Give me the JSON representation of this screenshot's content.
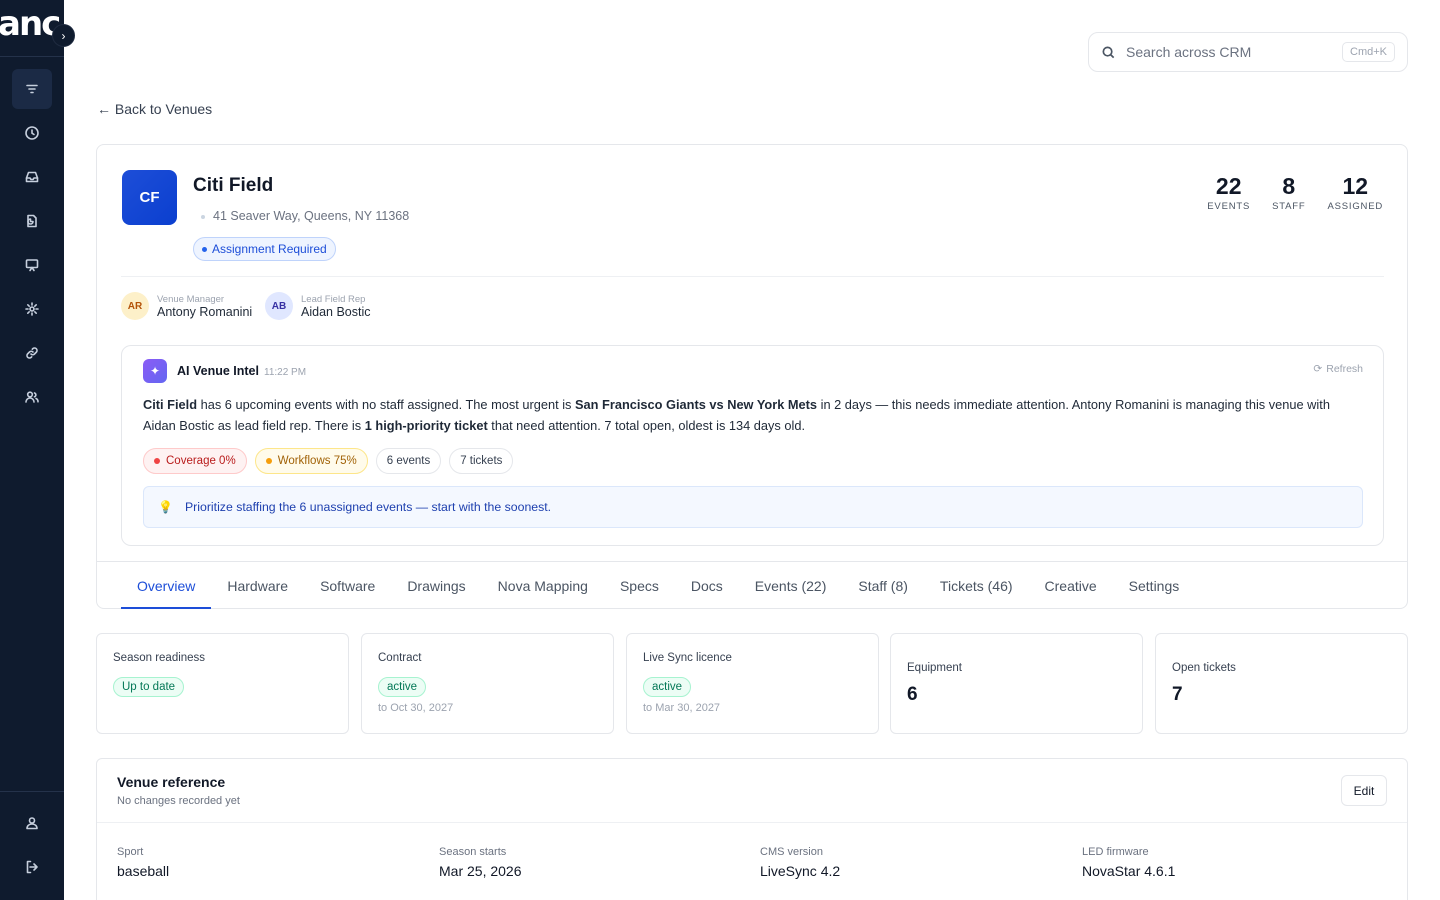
{
  "app": {
    "logo_text": "anc"
  },
  "search": {
    "placeholder": "Search across CRM",
    "shortcut": "Cmd+K"
  },
  "back_link": "← Back to Venues",
  "venue": {
    "initials": "CF",
    "name": "Citi Field",
    "address": "41 Seaver Way, Queens, NY 11368",
    "badge": "Assignment Required",
    "stats": [
      {
        "value": "22",
        "label": "EVENTS"
      },
      {
        "value": "8",
        "label": "STAFF"
      },
      {
        "value": "12",
        "label": "ASSIGNED"
      }
    ],
    "people": [
      {
        "initials": "AR",
        "role": "Venue Manager",
        "name": "Antony Romanini"
      },
      {
        "initials": "AB",
        "role": "Lead Field Rep",
        "name": "Aidan Bostic"
      }
    ]
  },
  "ai": {
    "title": "AI Venue Intel",
    "time": "11:22 PM",
    "refresh_label": "Refresh",
    "text": {
      "p1_bold": "Citi Field",
      "p1": " has 6 upcoming events with no staff assigned. The most urgent is ",
      "p2_bold": "San Francisco Giants vs New York Mets",
      "p2": " in 2 days — this needs immediate attention. Antony Romanini is managing this venue with Aidan Bostic as lead field rep. There is ",
      "p3_bold": "1 high-priority ticket",
      "p3": " that need attention. 7 total open, oldest is 134 days old."
    },
    "chips": [
      "Coverage 0%",
      "Workflows 75%",
      "6 events",
      "7 tickets"
    ],
    "tip": "Prioritize staffing the 6 unassigned events — start with the soonest.",
    "colors": {
      "coverage": "#ef4444",
      "workflows": "#f59e0b"
    }
  },
  "tabs": [
    "Overview",
    "Hardware",
    "Software",
    "Drawings",
    "Nova Mapping",
    "Specs",
    "Docs",
    "Events (22)",
    "Staff (8)",
    "Tickets (46)",
    "Creative",
    "Settings"
  ],
  "metrics": {
    "season": {
      "label": "Season readiness",
      "status": "Up to date"
    },
    "contract": {
      "label": "Contract",
      "status": "active",
      "sub": "to Oct 30, 2027"
    },
    "licence": {
      "label": "Live Sync licence",
      "status": "active",
      "sub": "to Mar 30, 2027"
    },
    "equipment": {
      "label": "Equipment",
      "value": "6"
    },
    "tickets": {
      "label": "Open tickets",
      "value": "7"
    }
  },
  "reference": {
    "title": "Venue reference",
    "subtitle": "No changes recorded yet",
    "edit_label": "Edit",
    "fields": [
      {
        "label": "Sport",
        "value": "baseball"
      },
      {
        "label": "Season starts",
        "value": "Mar 25, 2026"
      },
      {
        "label": "CMS version",
        "value": "LiveSync 4.2"
      },
      {
        "label": "LED firmware",
        "value": "NovaStar 4.6.1"
      }
    ]
  }
}
